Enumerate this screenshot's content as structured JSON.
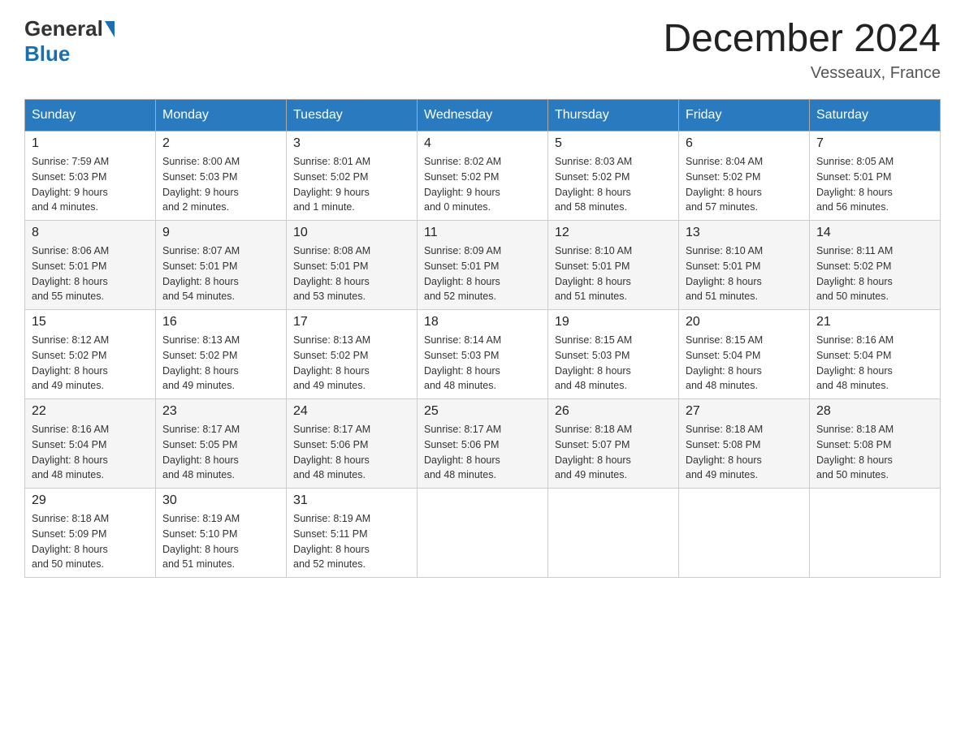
{
  "header": {
    "logo_general": "General",
    "logo_blue": "Blue",
    "month_year": "December 2024",
    "location": "Vesseaux, France"
  },
  "days_of_week": [
    "Sunday",
    "Monday",
    "Tuesday",
    "Wednesday",
    "Thursday",
    "Friday",
    "Saturday"
  ],
  "weeks": [
    [
      {
        "day": "1",
        "sunrise": "Sunrise: 7:59 AM",
        "sunset": "Sunset: 5:03 PM",
        "daylight": "Daylight: 9 hours and 4 minutes."
      },
      {
        "day": "2",
        "sunrise": "Sunrise: 8:00 AM",
        "sunset": "Sunset: 5:03 PM",
        "daylight": "Daylight: 9 hours and 2 minutes."
      },
      {
        "day": "3",
        "sunrise": "Sunrise: 8:01 AM",
        "sunset": "Sunset: 5:02 PM",
        "daylight": "Daylight: 9 hours and 1 minute."
      },
      {
        "day": "4",
        "sunrise": "Sunrise: 8:02 AM",
        "sunset": "Sunset: 5:02 PM",
        "daylight": "Daylight: 9 hours and 0 minutes."
      },
      {
        "day": "5",
        "sunrise": "Sunrise: 8:03 AM",
        "sunset": "Sunset: 5:02 PM",
        "daylight": "Daylight: 8 hours and 58 minutes."
      },
      {
        "day": "6",
        "sunrise": "Sunrise: 8:04 AM",
        "sunset": "Sunset: 5:02 PM",
        "daylight": "Daylight: 8 hours and 57 minutes."
      },
      {
        "day": "7",
        "sunrise": "Sunrise: 8:05 AM",
        "sunset": "Sunset: 5:01 PM",
        "daylight": "Daylight: 8 hours and 56 minutes."
      }
    ],
    [
      {
        "day": "8",
        "sunrise": "Sunrise: 8:06 AM",
        "sunset": "Sunset: 5:01 PM",
        "daylight": "Daylight: 8 hours and 55 minutes."
      },
      {
        "day": "9",
        "sunrise": "Sunrise: 8:07 AM",
        "sunset": "Sunset: 5:01 PM",
        "daylight": "Daylight: 8 hours and 54 minutes."
      },
      {
        "day": "10",
        "sunrise": "Sunrise: 8:08 AM",
        "sunset": "Sunset: 5:01 PM",
        "daylight": "Daylight: 8 hours and 53 minutes."
      },
      {
        "day": "11",
        "sunrise": "Sunrise: 8:09 AM",
        "sunset": "Sunset: 5:01 PM",
        "daylight": "Daylight: 8 hours and 52 minutes."
      },
      {
        "day": "12",
        "sunrise": "Sunrise: 8:10 AM",
        "sunset": "Sunset: 5:01 PM",
        "daylight": "Daylight: 8 hours and 51 minutes."
      },
      {
        "day": "13",
        "sunrise": "Sunrise: 8:10 AM",
        "sunset": "Sunset: 5:01 PM",
        "daylight": "Daylight: 8 hours and 51 minutes."
      },
      {
        "day": "14",
        "sunrise": "Sunrise: 8:11 AM",
        "sunset": "Sunset: 5:02 PM",
        "daylight": "Daylight: 8 hours and 50 minutes."
      }
    ],
    [
      {
        "day": "15",
        "sunrise": "Sunrise: 8:12 AM",
        "sunset": "Sunset: 5:02 PM",
        "daylight": "Daylight: 8 hours and 49 minutes."
      },
      {
        "day": "16",
        "sunrise": "Sunrise: 8:13 AM",
        "sunset": "Sunset: 5:02 PM",
        "daylight": "Daylight: 8 hours and 49 minutes."
      },
      {
        "day": "17",
        "sunrise": "Sunrise: 8:13 AM",
        "sunset": "Sunset: 5:02 PM",
        "daylight": "Daylight: 8 hours and 49 minutes."
      },
      {
        "day": "18",
        "sunrise": "Sunrise: 8:14 AM",
        "sunset": "Sunset: 5:03 PM",
        "daylight": "Daylight: 8 hours and 48 minutes."
      },
      {
        "day": "19",
        "sunrise": "Sunrise: 8:15 AM",
        "sunset": "Sunset: 5:03 PM",
        "daylight": "Daylight: 8 hours and 48 minutes."
      },
      {
        "day": "20",
        "sunrise": "Sunrise: 8:15 AM",
        "sunset": "Sunset: 5:04 PM",
        "daylight": "Daylight: 8 hours and 48 minutes."
      },
      {
        "day": "21",
        "sunrise": "Sunrise: 8:16 AM",
        "sunset": "Sunset: 5:04 PM",
        "daylight": "Daylight: 8 hours and 48 minutes."
      }
    ],
    [
      {
        "day": "22",
        "sunrise": "Sunrise: 8:16 AM",
        "sunset": "Sunset: 5:04 PM",
        "daylight": "Daylight: 8 hours and 48 minutes."
      },
      {
        "day": "23",
        "sunrise": "Sunrise: 8:17 AM",
        "sunset": "Sunset: 5:05 PM",
        "daylight": "Daylight: 8 hours and 48 minutes."
      },
      {
        "day": "24",
        "sunrise": "Sunrise: 8:17 AM",
        "sunset": "Sunset: 5:06 PM",
        "daylight": "Daylight: 8 hours and 48 minutes."
      },
      {
        "day": "25",
        "sunrise": "Sunrise: 8:17 AM",
        "sunset": "Sunset: 5:06 PM",
        "daylight": "Daylight: 8 hours and 48 minutes."
      },
      {
        "day": "26",
        "sunrise": "Sunrise: 8:18 AM",
        "sunset": "Sunset: 5:07 PM",
        "daylight": "Daylight: 8 hours and 49 minutes."
      },
      {
        "day": "27",
        "sunrise": "Sunrise: 8:18 AM",
        "sunset": "Sunset: 5:08 PM",
        "daylight": "Daylight: 8 hours and 49 minutes."
      },
      {
        "day": "28",
        "sunrise": "Sunrise: 8:18 AM",
        "sunset": "Sunset: 5:08 PM",
        "daylight": "Daylight: 8 hours and 50 minutes."
      }
    ],
    [
      {
        "day": "29",
        "sunrise": "Sunrise: 8:18 AM",
        "sunset": "Sunset: 5:09 PM",
        "daylight": "Daylight: 8 hours and 50 minutes."
      },
      {
        "day": "30",
        "sunrise": "Sunrise: 8:19 AM",
        "sunset": "Sunset: 5:10 PM",
        "daylight": "Daylight: 8 hours and 51 minutes."
      },
      {
        "day": "31",
        "sunrise": "Sunrise: 8:19 AM",
        "sunset": "Sunset: 5:11 PM",
        "daylight": "Daylight: 8 hours and 52 minutes."
      },
      null,
      null,
      null,
      null
    ]
  ]
}
